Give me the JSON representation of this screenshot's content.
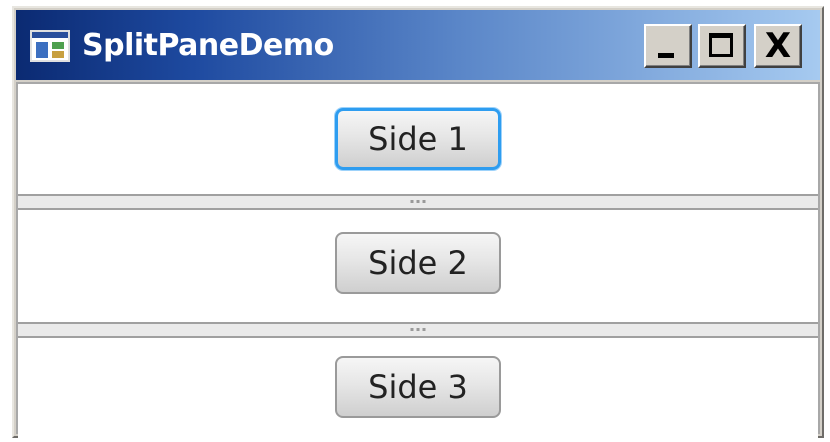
{
  "window": {
    "title": "SplitPaneDemo",
    "controls": {
      "minimize_icon": "minimize-icon",
      "maximize_icon": "maximize-icon",
      "close_glyph": "X"
    }
  },
  "panes": [
    {
      "button_label": "Side 1",
      "focused": true
    },
    {
      "button_label": "Side 2",
      "focused": false
    },
    {
      "button_label": "Side 3",
      "focused": false
    }
  ],
  "colors": {
    "titlebar_start": "#0b2a72",
    "titlebar_end": "#a6caf0",
    "focus_ring": "#2e9df0"
  }
}
